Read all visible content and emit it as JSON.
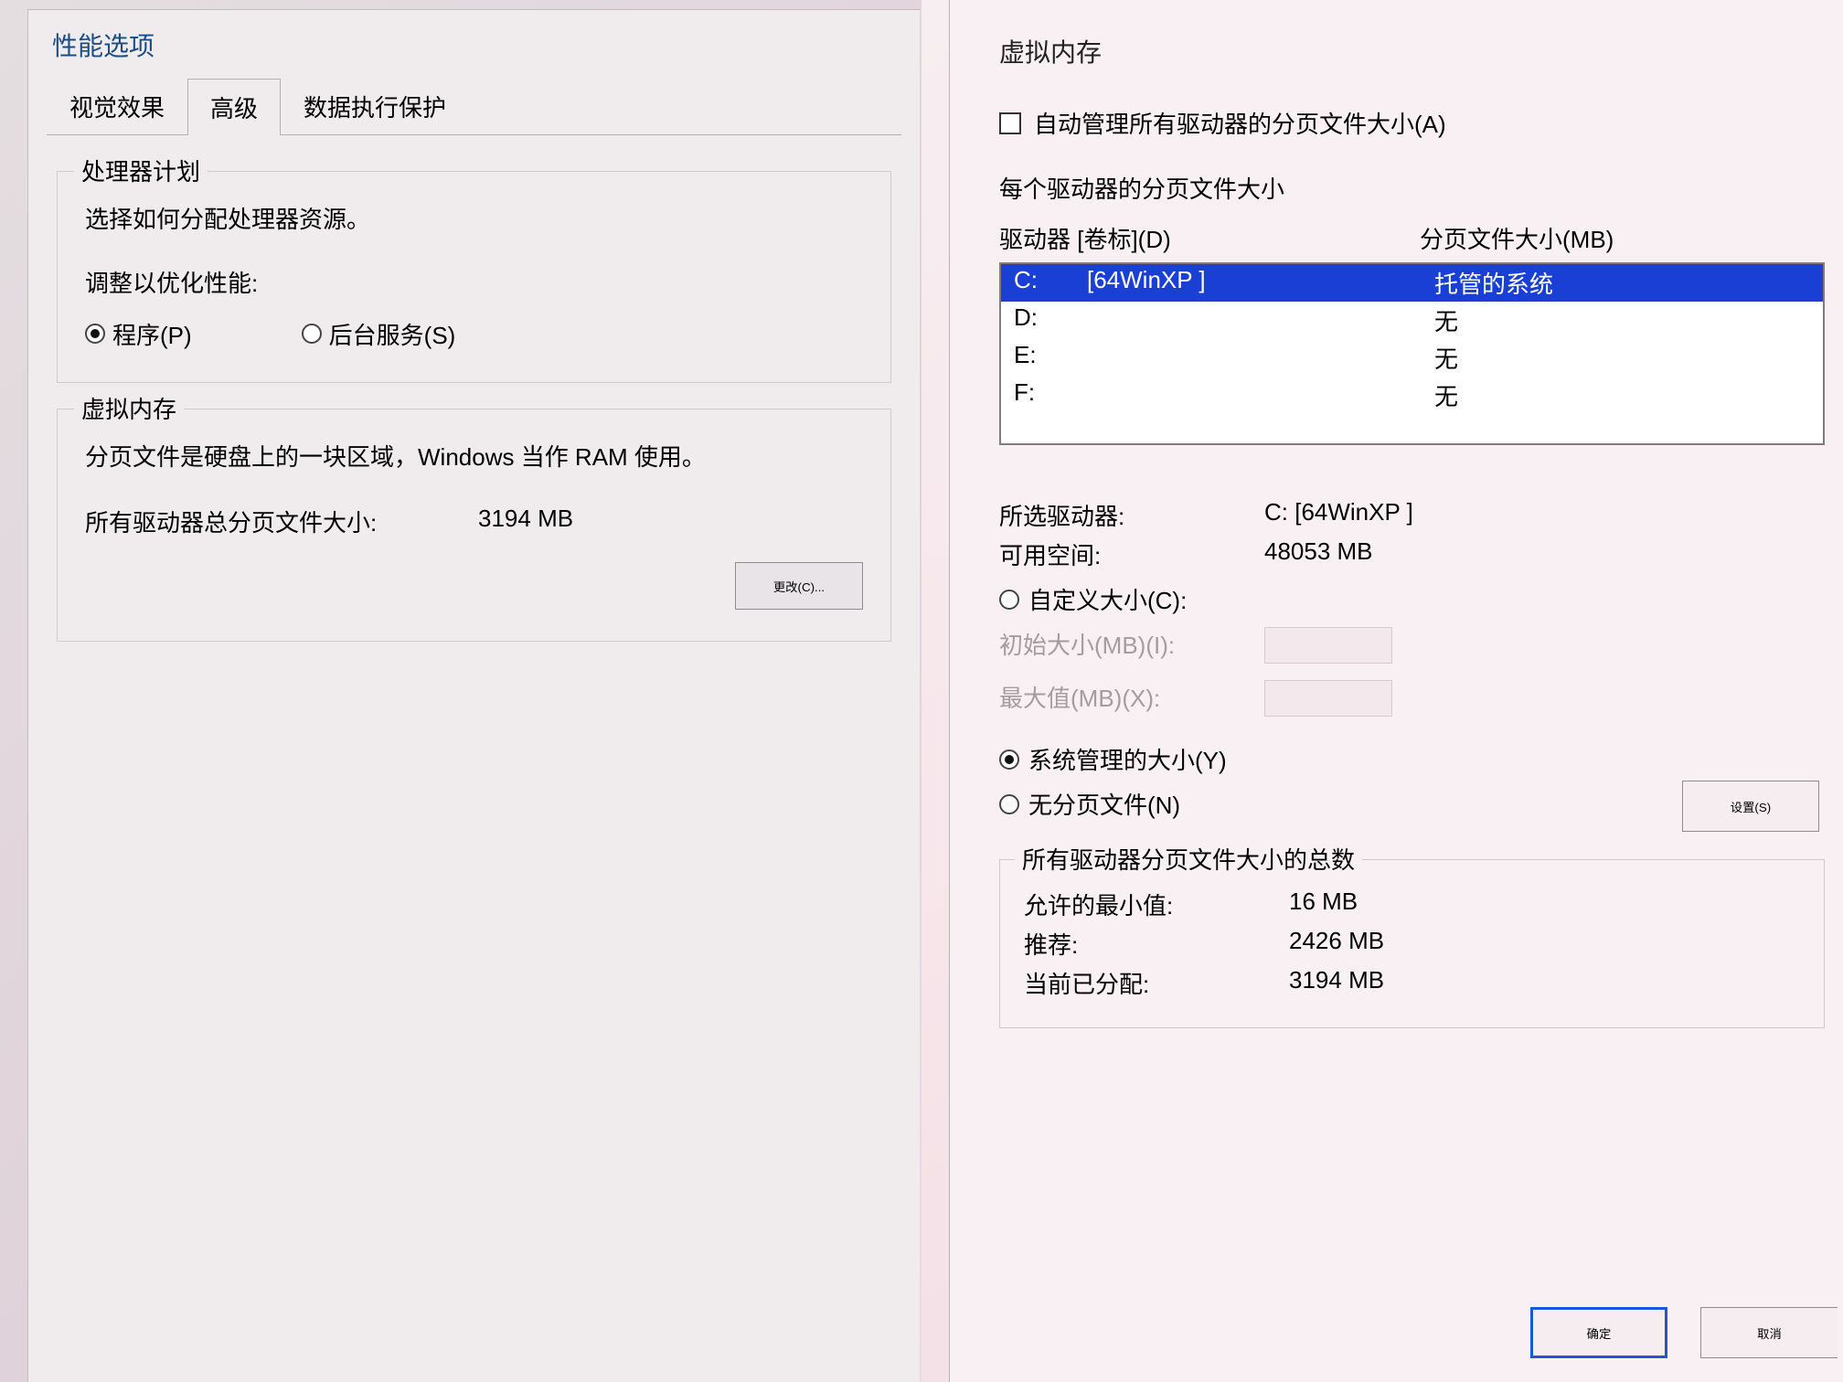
{
  "left": {
    "title": "性能选项",
    "tabs": [
      "视觉效果",
      "高级",
      "数据执行保护"
    ],
    "active_tab": 1,
    "processor": {
      "title": "处理器计划",
      "desc": "选择如何分配处理器资源。",
      "adjust_label": "调整以优化性能:",
      "option_programs": "程序(P)",
      "option_bg": "后台服务(S)",
      "selected": "programs"
    },
    "vm": {
      "title": "虚拟内存",
      "desc": "分页文件是硬盘上的一块区域，Windows 当作 RAM 使用。",
      "total_label": "所有驱动器总分页文件大小:",
      "total_value": "3194 MB",
      "change_btn": "更改(C)..."
    }
  },
  "right": {
    "title": "虚拟内存",
    "auto_label": "自动管理所有驱动器的分页文件大小(A)",
    "auto_checked": false,
    "per_drive_label": "每个驱动器的分页文件大小",
    "col_drive": "驱动器 [卷标](D)",
    "col_size": "分页文件大小(MB)",
    "drives": [
      {
        "d": "C:",
        "l": "[64WinXP ]",
        "s": "托管的系统",
        "sel": true
      },
      {
        "d": "D:",
        "l": "",
        "s": "无",
        "sel": false
      },
      {
        "d": "E:",
        "l": "",
        "s": "无",
        "sel": false
      },
      {
        "d": "F:",
        "l": "",
        "s": "无",
        "sel": false
      }
    ],
    "selected_drive_label": "所选驱动器:",
    "selected_drive_value": "C:  [64WinXP ]",
    "free_label": "可用空间:",
    "free_value": "48053 MB",
    "custom_label": "自定义大小(C):",
    "initial_label": "初始大小(MB)(I):",
    "max_label": "最大值(MB)(X):",
    "sys_managed_label": "系统管理的大小(Y)",
    "no_page_label": "无分页文件(N)",
    "size_mode": "system",
    "set_btn": "设置(S)",
    "totals": {
      "title": "所有驱动器分页文件大小的总数",
      "min_label": "允许的最小值:",
      "min_value": "16 MB",
      "rec_label": "推荐:",
      "rec_value": "2426 MB",
      "cur_label": "当前已分配:",
      "cur_value": "3194 MB"
    },
    "ok_btn": "确定",
    "cancel_btn": "取消"
  }
}
